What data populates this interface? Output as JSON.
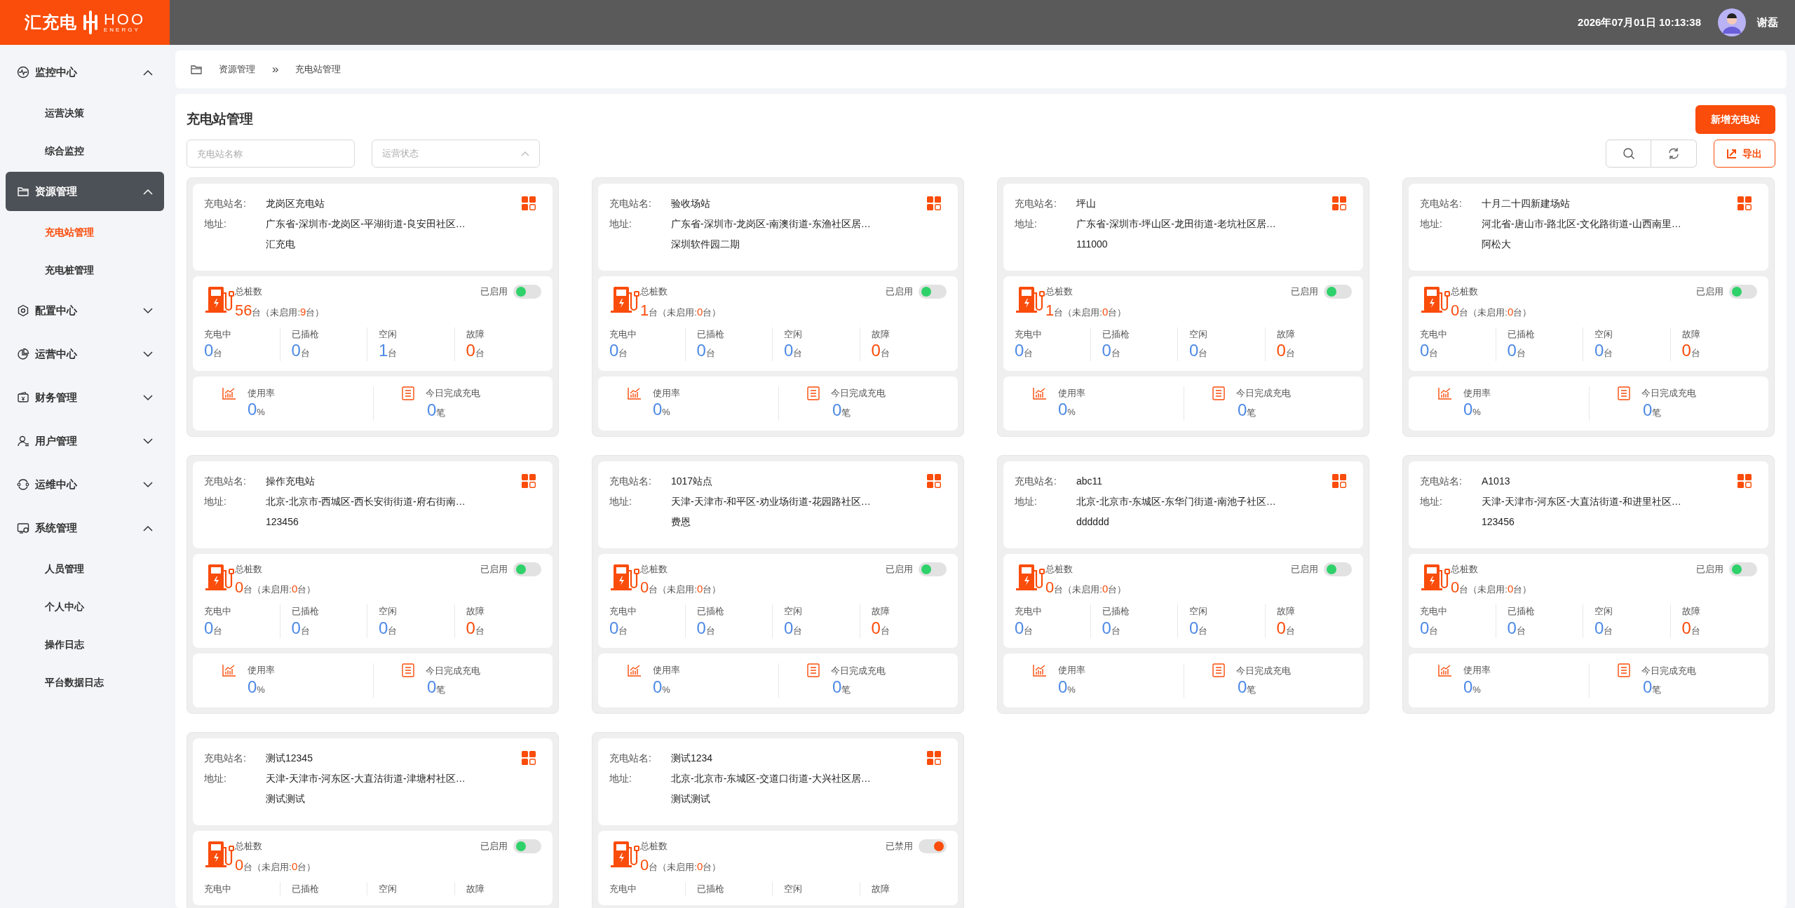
{
  "logo": {
    "name": "汇充电",
    "brand": "HOO",
    "tagline": "ENERGY"
  },
  "header": {
    "datetime": "2026年07月01日 10:13:38",
    "user": "谢磊"
  },
  "sidebar": {
    "items": [
      {
        "label": "监控中心",
        "expanded": true,
        "selected": false,
        "children": [
          {
            "label": "运营决策",
            "selected": false
          },
          {
            "label": "综合监控",
            "selected": false
          }
        ]
      },
      {
        "label": "资源管理",
        "expanded": true,
        "selected": true,
        "children": [
          {
            "label": "充电站管理",
            "selected": true
          },
          {
            "label": "充电桩管理",
            "selected": false
          }
        ]
      },
      {
        "label": "配置中心",
        "expanded": false,
        "selected": false
      },
      {
        "label": "运营中心",
        "expanded": false,
        "selected": false
      },
      {
        "label": "财务管理",
        "expanded": false,
        "selected": false
      },
      {
        "label": "用户管理",
        "expanded": false,
        "selected": false
      },
      {
        "label": "运维中心",
        "expanded": false,
        "selected": false
      },
      {
        "label": "系统管理",
        "expanded": true,
        "selected": false,
        "children": [
          {
            "label": "人员管理",
            "selected": false
          },
          {
            "label": "个人中心",
            "selected": false
          },
          {
            "label": "操作日志",
            "selected": false
          },
          {
            "label": "平台数据日志",
            "selected": false
          }
        ]
      }
    ]
  },
  "breadcrumb": [
    "资源管理",
    "»",
    "充电站管理"
  ],
  "page": {
    "title": "充电站管理",
    "add_button": "新增充电站",
    "export_button": "导出",
    "search": {
      "placeholder": "充电站名称"
    },
    "status_select": {
      "placeholder": "运营状态"
    }
  },
  "stations": [
    {
      "name_label": "充电站名:",
      "name": "龙岗区充电站",
      "address_label": "地址:",
      "address": "广东省-深圳市-龙岗区-平湖街道-良安田社区…",
      "detail": "汇充电",
      "pile_label": "总桩数",
      "piles": [
        {
          "kind": "number",
          "text": "56"
        },
        {
          "kind": "unit",
          "text": "台（未启用:"
        },
        {
          "kind": "count",
          "text": "9"
        },
        {
          "kind": "unit",
          "text": "台）"
        }
      ],
      "disabled": false,
      "switch_label": "已启用",
      "stats": [
        {
          "label": "充电中",
          "value": "0",
          "unit": "台",
          "kind": "normal"
        },
        {
          "label": "已插枪",
          "value": "0",
          "unit": "台",
          "kind": "normal"
        },
        {
          "label": "空闲",
          "value": "1",
          "unit": "台",
          "kind": "normal"
        },
        {
          "label": "故障",
          "value": "0",
          "unit": "台",
          "kind": "fault"
        }
      ],
      "usage": [
        {
          "kind": "rate",
          "label": "使用率",
          "value": "0",
          "unit": "%"
        },
        {
          "kind": "orders",
          "label": "今日完成充电",
          "value": "0",
          "unit": "笔"
        }
      ]
    },
    {
      "name_label": "充电站名:",
      "name": "验收场站",
      "address_label": "地址:",
      "address": "广东省-深圳市-龙岗区-南澳街道-东渔社区居…",
      "detail": "深圳软件园二期",
      "pile_label": "总桩数",
      "piles": [
        {
          "kind": "number",
          "text": "1"
        },
        {
          "kind": "unit",
          "text": "台（未启用:"
        },
        {
          "kind": "count",
          "text": "0"
        },
        {
          "kind": "unit",
          "text": "台）"
        }
      ],
      "disabled": false,
      "switch_label": "已启用",
      "stats": [
        {
          "label": "充电中",
          "value": "0",
          "unit": "台",
          "kind": "normal"
        },
        {
          "label": "已插枪",
          "value": "0",
          "unit": "台",
          "kind": "normal"
        },
        {
          "label": "空闲",
          "value": "0",
          "unit": "台",
          "kind": "normal"
        },
        {
          "label": "故障",
          "value": "0",
          "unit": "台",
          "kind": "fault"
        }
      ],
      "usage": [
        {
          "kind": "rate",
          "label": "使用率",
          "value": "0",
          "unit": "%"
        },
        {
          "kind": "orders",
          "label": "今日完成充电",
          "value": "0",
          "unit": "笔"
        }
      ]
    },
    {
      "name_label": "充电站名:",
      "name": "坪山",
      "address_label": "地址:",
      "address": "广东省-深圳市-坪山区-龙田街道-老坑社区居…",
      "detail": "111000",
      "pile_label": "总桩数",
      "piles": [
        {
          "kind": "number",
          "text": "1"
        },
        {
          "kind": "unit",
          "text": "台（未启用:"
        },
        {
          "kind": "count",
          "text": "0"
        },
        {
          "kind": "unit",
          "text": "台）"
        }
      ],
      "disabled": false,
      "switch_label": "已启用",
      "stats": [
        {
          "label": "充电中",
          "value": "0",
          "unit": "台",
          "kind": "normal"
        },
        {
          "label": "已插枪",
          "value": "0",
          "unit": "台",
          "kind": "normal"
        },
        {
          "label": "空闲",
          "value": "0",
          "unit": "台",
          "kind": "normal"
        },
        {
          "label": "故障",
          "value": "0",
          "unit": "台",
          "kind": "fault"
        }
      ],
      "usage": [
        {
          "kind": "rate",
          "label": "使用率",
          "value": "0",
          "unit": "%"
        },
        {
          "kind": "orders",
          "label": "今日完成充电",
          "value": "0",
          "unit": "笔"
        }
      ]
    },
    {
      "name_label": "充电站名:",
      "name": "十月二十四新建场站",
      "address_label": "地址:",
      "address": "河北省-唐山市-路北区-文化路街道-山西南里…",
      "detail": "阿松大",
      "pile_label": "总桩数",
      "piles": [
        {
          "kind": "number",
          "text": "0"
        },
        {
          "kind": "unit",
          "text": "台（未启用:"
        },
        {
          "kind": "count",
          "text": "0"
        },
        {
          "kind": "unit",
          "text": "台）"
        }
      ],
      "disabled": false,
      "switch_label": "已启用",
      "stats": [
        {
          "label": "充电中",
          "value": "0",
          "unit": "台",
          "kind": "normal"
        },
        {
          "label": "已插枪",
          "value": "0",
          "unit": "台",
          "kind": "normal"
        },
        {
          "label": "空闲",
          "value": "0",
          "unit": "台",
          "kind": "normal"
        },
        {
          "label": "故障",
          "value": "0",
          "unit": "台",
          "kind": "fault"
        }
      ],
      "usage": [
        {
          "kind": "rate",
          "label": "使用率",
          "value": "0",
          "unit": "%"
        },
        {
          "kind": "orders",
          "label": "今日完成充电",
          "value": "0",
          "unit": "笔"
        }
      ]
    },
    {
      "name_label": "充电站名:",
      "name": "操作充电站",
      "address_label": "地址:",
      "address": "北京-北京市-西城区-西长安街街道-府右街南…",
      "detail": "123456",
      "pile_label": "总桩数",
      "piles": [
        {
          "kind": "number",
          "text": "0"
        },
        {
          "kind": "unit",
          "text": "台（未启用:"
        },
        {
          "kind": "count",
          "text": "0"
        },
        {
          "kind": "unit",
          "text": "台）"
        }
      ],
      "disabled": false,
      "switch_label": "已启用",
      "stats": [
        {
          "label": "充电中",
          "value": "0",
          "unit": "台",
          "kind": "normal"
        },
        {
          "label": "已插枪",
          "value": "0",
          "unit": "台",
          "kind": "normal"
        },
        {
          "label": "空闲",
          "value": "0",
          "unit": "台",
          "kind": "normal"
        },
        {
          "label": "故障",
          "value": "0",
          "unit": "台",
          "kind": "fault"
        }
      ],
      "usage": [
        {
          "kind": "rate",
          "label": "使用率",
          "value": "0",
          "unit": "%"
        },
        {
          "kind": "orders",
          "label": "今日完成充电",
          "value": "0",
          "unit": "笔"
        }
      ]
    },
    {
      "name_label": "充电站名:",
      "name": "1017站点",
      "address_label": "地址:",
      "address": "天津-天津市-和平区-劝业场街道-花园路社区…",
      "detail": "费恩",
      "pile_label": "总桩数",
      "piles": [
        {
          "kind": "number",
          "text": "0"
        },
        {
          "kind": "unit",
          "text": "台（未启用:"
        },
        {
          "kind": "count",
          "text": "0"
        },
        {
          "kind": "unit",
          "text": "台）"
        }
      ],
      "disabled": false,
      "switch_label": "已启用",
      "stats": [
        {
          "label": "充电中",
          "value": "0",
          "unit": "台",
          "kind": "normal"
        },
        {
          "label": "已插枪",
          "value": "0",
          "unit": "台",
          "kind": "normal"
        },
        {
          "label": "空闲",
          "value": "0",
          "unit": "台",
          "kind": "normal"
        },
        {
          "label": "故障",
          "value": "0",
          "unit": "台",
          "kind": "fault"
        }
      ],
      "usage": [
        {
          "kind": "rate",
          "label": "使用率",
          "value": "0",
          "unit": "%"
        },
        {
          "kind": "orders",
          "label": "今日完成充电",
          "value": "0",
          "unit": "笔"
        }
      ]
    },
    {
      "name_label": "充电站名:",
      "name": "abc11",
      "address_label": "地址:",
      "address": "北京-北京市-东城区-东华门街道-南池子社区…",
      "detail": "dddddd",
      "pile_label": "总桩数",
      "piles": [
        {
          "kind": "number",
          "text": "0"
        },
        {
          "kind": "unit",
          "text": "台（未启用:"
        },
        {
          "kind": "count",
          "text": "0"
        },
        {
          "kind": "unit",
          "text": "台）"
        }
      ],
      "disabled": false,
      "switch_label": "已启用",
      "stats": [
        {
          "label": "充电中",
          "value": "0",
          "unit": "台",
          "kind": "normal"
        },
        {
          "label": "已插枪",
          "value": "0",
          "unit": "台",
          "kind": "normal"
        },
        {
          "label": "空闲",
          "value": "0",
          "unit": "台",
          "kind": "normal"
        },
        {
          "label": "故障",
          "value": "0",
          "unit": "台",
          "kind": "fault"
        }
      ],
      "usage": [
        {
          "kind": "rate",
          "label": "使用率",
          "value": "0",
          "unit": "%"
        },
        {
          "kind": "orders",
          "label": "今日完成充电",
          "value": "0",
          "unit": "笔"
        }
      ]
    },
    {
      "name_label": "充电站名:",
      "name": "A1013",
      "address_label": "地址:",
      "address": "天津-天津市-河东区-大直沽街道-和进里社区…",
      "detail": "123456",
      "pile_label": "总桩数",
      "piles": [
        {
          "kind": "number",
          "text": "0"
        },
        {
          "kind": "unit",
          "text": "台（未启用:"
        },
        {
          "kind": "count",
          "text": "0"
        },
        {
          "kind": "unit",
          "text": "台）"
        }
      ],
      "disabled": false,
      "switch_label": "已启用",
      "stats": [
        {
          "label": "充电中",
          "value": "0",
          "unit": "台",
          "kind": "normal"
        },
        {
          "label": "已插枪",
          "value": "0",
          "unit": "台",
          "kind": "normal"
        },
        {
          "label": "空闲",
          "value": "0",
          "unit": "台",
          "kind": "normal"
        },
        {
          "label": "故障",
          "value": "0",
          "unit": "台",
          "kind": "fault"
        }
      ],
      "usage": [
        {
          "kind": "rate",
          "label": "使用率",
          "value": "0",
          "unit": "%"
        },
        {
          "kind": "orders",
          "label": "今日完成充电",
          "value": "0",
          "unit": "笔"
        }
      ]
    },
    {
      "name_label": "充电站名:",
      "name": "测试12345",
      "address_label": "地址:",
      "address": "天津-天津市-河东区-大直沽街道-津塘村社区…",
      "detail": "测试测试",
      "pile_label": "总桩数",
      "piles": [
        {
          "kind": "number",
          "text": "0"
        },
        {
          "kind": "unit",
          "text": "台（未启用:"
        },
        {
          "kind": "count",
          "text": "0"
        },
        {
          "kind": "unit",
          "text": "台）"
        }
      ],
      "disabled": false,
      "switch_label": "已启用",
      "stats": [
        {
          "label": "充电中"
        },
        {
          "label": "已插枪"
        },
        {
          "label": "空闲"
        },
        {
          "label": "故障"
        }
      ]
    },
    {
      "name_label": "充电站名:",
      "name": "测试1234",
      "address_label": "地址:",
      "address": "北京-北京市-东城区-交道口街道-大兴社区居…",
      "detail": "测试测试",
      "pile_label": "总桩数",
      "piles": [
        {
          "kind": "number",
          "text": "0"
        },
        {
          "kind": "unit",
          "text": "台（未启用:"
        },
        {
          "kind": "count",
          "text": "0"
        },
        {
          "kind": "unit",
          "text": "台）"
        }
      ],
      "disabled": true,
      "switch_label": "已禁用",
      "stats": [
        {
          "label": "充电中"
        },
        {
          "label": "已插枪"
        },
        {
          "label": "空闲"
        },
        {
          "label": "故障"
        }
      ]
    }
  ]
}
